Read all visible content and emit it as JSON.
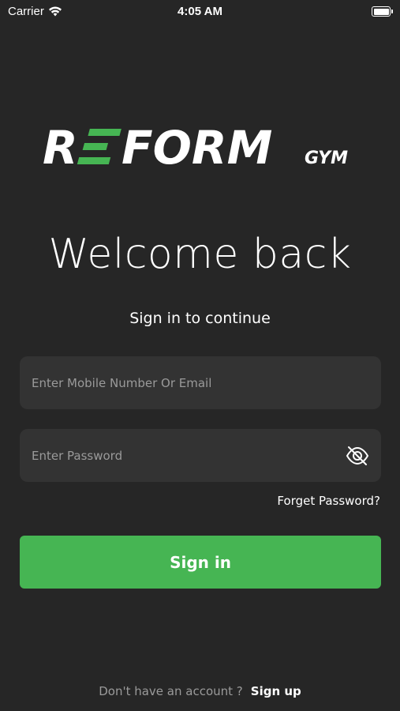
{
  "status_bar": {
    "carrier": "Carrier",
    "time": "4:05 AM"
  },
  "logo": {
    "brand": "REFORM",
    "suffix": "GYM",
    "accent_color": "#46b553"
  },
  "welcome": {
    "title": "Welcome back",
    "subtitle": "Sign in to continue"
  },
  "form": {
    "email_placeholder": "Enter Mobile Number Or Email",
    "password_placeholder": "Enter Password",
    "password_toggle_icon": "eye-off-icon",
    "forgot_label": "Forget Password?",
    "submit_label": "Sign in"
  },
  "footer": {
    "prompt": "Don't have an account ?",
    "signup_label": "Sign up"
  },
  "colors": {
    "background": "#262626",
    "field": "#333333",
    "primary": "#46b553"
  }
}
